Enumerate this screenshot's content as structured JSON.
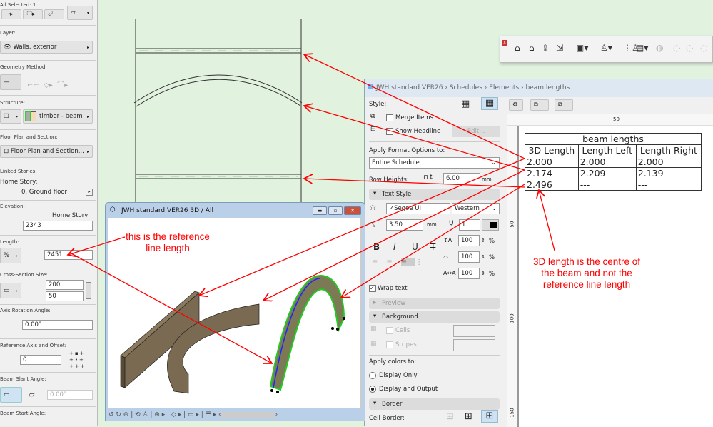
{
  "info_box": {
    "selection": "All Selected: 1",
    "layer_label": "Layer:",
    "layer_value": "Walls, exterior",
    "geometry_label": "Geometry Method:",
    "structure_label": "Structure:",
    "structure_value": "timber - beam",
    "floorplan_label": "Floor Plan and Section:",
    "floorplan_value": "Floor Plan and Section...",
    "linked_label": "Linked Stories:",
    "home_story_label": "Home Story:",
    "home_story_value": "0. Ground floor",
    "elevation_label": "Elevation:",
    "elevation_ref": "Home Story",
    "elevation_value": "2343",
    "length_label": "Length:",
    "length_value": "2451",
    "cross_label": "Cross-Section Size:",
    "height_value": "200",
    "width_value": "50",
    "axis_rot_label": "Axis Rotation Angle:",
    "axis_rot_value": "0.00°",
    "ref_axis_label": "Reference Axis and Offset:",
    "offset_value": "0",
    "slant_label": "Beam Slant Angle:",
    "slant_value": "0.00°",
    "start_label": "Beam Start Angle:"
  },
  "schedule": {
    "title": "JWH standard VER26 › Schedules › Elements › beam lengths",
    "style_label": "Style:",
    "merge_items": "Merge Items",
    "show_headline": "Show Headline",
    "edit_button": "Edit...",
    "apply_format_label": "Apply Format Options to:",
    "apply_format_value": "Entire Schedule",
    "row_heights_label": "Row Heights:",
    "row_heights_value": "6.00",
    "unit_mm": "mm",
    "text_style_header": "Text Style",
    "font_value": "✓Segoe UI",
    "script_value": "Western",
    "font_size": "3.50",
    "pen": "1",
    "pct1": "100",
    "pct2": "100",
    "pct3": "100",
    "pct": "%",
    "bold": "B",
    "italic": "I",
    "underline": "U",
    "strike": "T",
    "wrap_text": "Wrap text",
    "preview_header": "Preview",
    "background_header": "Background",
    "cells": "Cells",
    "stripes": "Stripes",
    "apply_colors_label": "Apply colors to:",
    "display_only": "Display Only",
    "display_output": "Display and Output",
    "border_header": "Border",
    "cell_border_label": "Cell Border:",
    "ruler_h": "50",
    "ruler_v": [
      "50",
      "100",
      "150"
    ],
    "table": {
      "title": "beam lengths",
      "headers": [
        "3D Length",
        "Length Left",
        "Length Right"
      ],
      "rows": [
        [
          "2.000",
          "2.000",
          "2.000"
        ],
        [
          "2.174",
          "2.209",
          "2.139"
        ],
        [
          "2.496",
          "---",
          "---"
        ]
      ]
    }
  },
  "window3d": {
    "title": "JWH standard VER26 3D / All"
  },
  "annotations": {
    "ref_note_1": "this is the reference",
    "ref_note_2": "line length",
    "centre_note_1": "3D length is the centre of",
    "centre_note_2": "the beam and not the",
    "centre_note_3": "reference line length"
  },
  "colors": {
    "annotation": "#ff0000",
    "canvas": "#e1f2df",
    "beam": "#7a6a52",
    "selection": "#22cc22"
  }
}
